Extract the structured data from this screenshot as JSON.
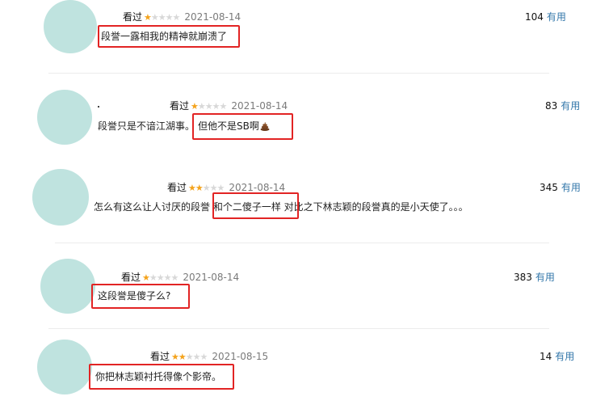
{
  "comments": [
    {
      "status": "看过",
      "rating": 1,
      "date": "2021-08-14",
      "votes": "104",
      "useful_label": "有用",
      "text": "段誉一露相我的精神就崩溃了"
    },
    {
      "status": "看过",
      "rating": 1,
      "date": "2021-08-14",
      "votes": "83",
      "useful_label": "有用",
      "text_a": "段誉只是不谙江湖事。",
      "text_b": "但他不是SB啊"
    },
    {
      "status": "看过",
      "rating": 2,
      "date": "2021-08-14",
      "votes": "345",
      "useful_label": "有用",
      "text": "怎么有这么让人讨厌的段誉 和个二傻子一样 对比之下林志颖的段誉真的是小天使了。。。"
    },
    {
      "status": "看过",
      "rating": 1,
      "date": "2021-08-14",
      "votes": "383",
      "useful_label": "有用",
      "text": "这段誉是傻子么?"
    },
    {
      "status": "看过",
      "rating": 2,
      "date": "2021-08-15",
      "votes": "14",
      "useful_label": "有用",
      "text": "你把林志颖衬托得像个影帝。"
    }
  ],
  "star_max": 5,
  "colors": {
    "highlight": "#e22424",
    "star_on": "#f4a31c",
    "star_off": "#d8d8d8",
    "link": "#3377aa",
    "avatar": "#bfe3df"
  },
  "icons": {
    "emoji": "poop-emoji-icon",
    "star": "star-icon"
  }
}
